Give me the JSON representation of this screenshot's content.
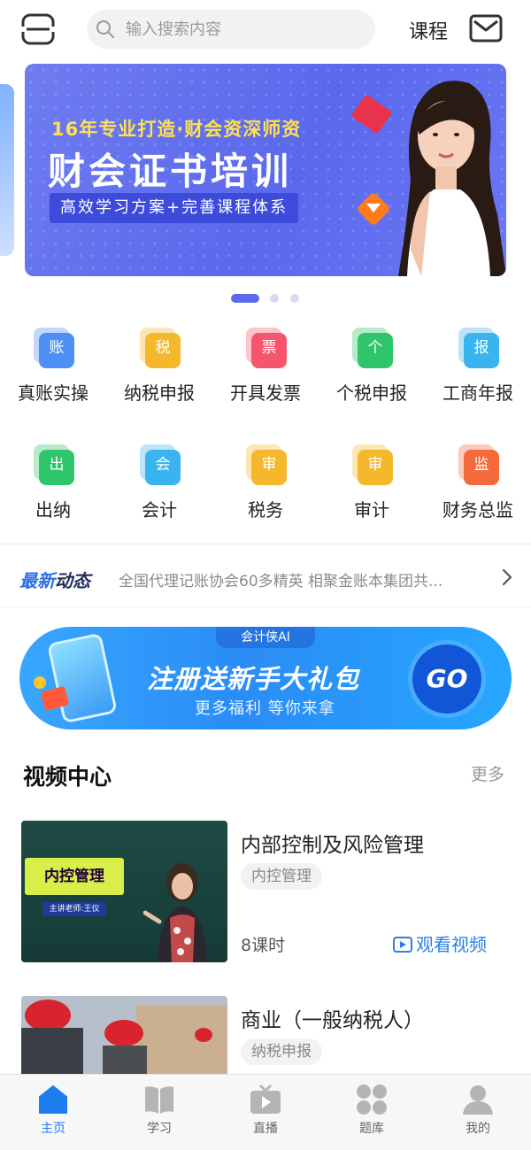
{
  "header": {
    "search_placeholder": "输入搜索内容",
    "course_label": "课程",
    "scan_icon": "scan-icon",
    "mail_icon": "mail-icon"
  },
  "banner": {
    "line1": "16年专业打造·财会资深师资",
    "line2": "财会证书培训",
    "line3": "高效学习方案+完善课程体系",
    "page_count": 3,
    "active_page": 1
  },
  "grid": [
    {
      "label": "真账实操",
      "glyph": "账",
      "color": "#4d8ff5"
    },
    {
      "label": "纳税申报",
      "glyph": "税",
      "color": "#f5b82c"
    },
    {
      "label": "开具发票",
      "glyph": "票",
      "color": "#f5566e"
    },
    {
      "label": "个税申报",
      "glyph": "个",
      "color": "#2fc66b"
    },
    {
      "label": "工商年报",
      "glyph": "报",
      "color": "#3ab4ef"
    },
    {
      "label": "出纳",
      "glyph": "出",
      "color": "#2fc66b"
    },
    {
      "label": "会计",
      "glyph": "会",
      "color": "#3ab4ef"
    },
    {
      "label": "税务",
      "glyph": "审",
      "color": "#f5b82c"
    },
    {
      "label": "审计",
      "glyph": "审",
      "color": "#f5b82c"
    },
    {
      "label": "财务总监",
      "glyph": "监",
      "color": "#f56a3c"
    }
  ],
  "news": {
    "tag_a": "最新",
    "tag_b": "动态",
    "text": "全国代理记账协会60多精英 相聚金账本集团共..."
  },
  "promo": {
    "tab": "会计侠AI",
    "title": "注册送新手大礼包",
    "subtitle": "更多福利  等你来拿",
    "go": "GO"
  },
  "video_center": {
    "title": "视频中心",
    "more": "更多",
    "items": [
      {
        "title": "内部控制及风险管理",
        "tag": "内控管理",
        "hours": "8课时",
        "watch": "观看视频",
        "thumb_board": "内控管理",
        "thumb_caption": "主讲老师:王仪"
      },
      {
        "title": "商业（一般纳税人）",
        "tag": "纳税申报"
      }
    ]
  },
  "tabbar": [
    {
      "label": "主页",
      "icon": "home-icon",
      "active": true
    },
    {
      "label": "学习",
      "icon": "book-icon",
      "active": false
    },
    {
      "label": "直播",
      "icon": "tv-icon",
      "active": false
    },
    {
      "label": "题库",
      "icon": "grid-icon",
      "active": false
    },
    {
      "label": "我的",
      "icon": "user-icon",
      "active": false
    }
  ],
  "colors": {
    "accent": "#1e7ef0",
    "banner_bg": "#5a68ec",
    "promo_bg": "#2a8cf5"
  }
}
